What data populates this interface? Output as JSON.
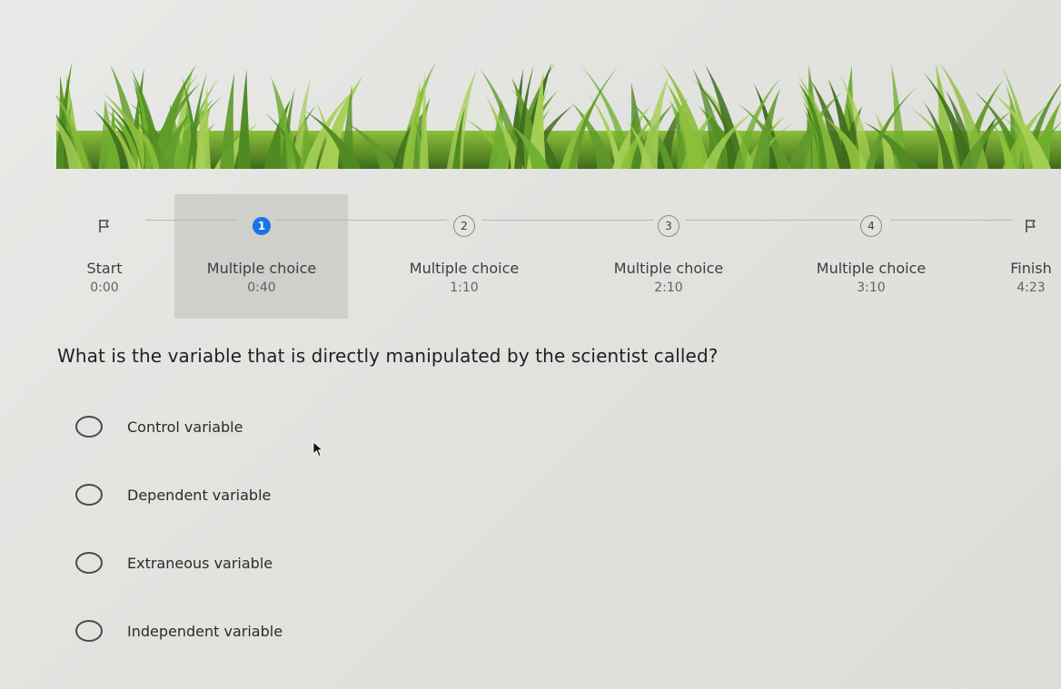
{
  "timeline": {
    "steps": [
      {
        "marker": "flag-icon",
        "label": "Start",
        "time": "0:00",
        "state": "done"
      },
      {
        "marker": "1",
        "label": "Multiple choice",
        "time": "0:40",
        "state": "current"
      },
      {
        "marker": "2",
        "label": "Multiple choice",
        "time": "1:10",
        "state": "upcoming"
      },
      {
        "marker": "3",
        "label": "Multiple choice",
        "time": "2:10",
        "state": "upcoming"
      },
      {
        "marker": "4",
        "label": "Multiple choice",
        "time": "3:10",
        "state": "upcoming"
      },
      {
        "marker": "flag-icon",
        "label": "Finish",
        "time": "4:23",
        "state": "upcoming"
      }
    ]
  },
  "question": {
    "text": "What is the variable that is directly manipulated by the scientist called?",
    "options": [
      "Control variable",
      "Dependent variable",
      "Extraneous variable",
      "Independent variable"
    ]
  },
  "colors": {
    "accent": "#1a73e8",
    "highlight": "#cfcfcc",
    "grass_dark": "#3e6b1c",
    "grass_light": "#8cbf3a"
  }
}
